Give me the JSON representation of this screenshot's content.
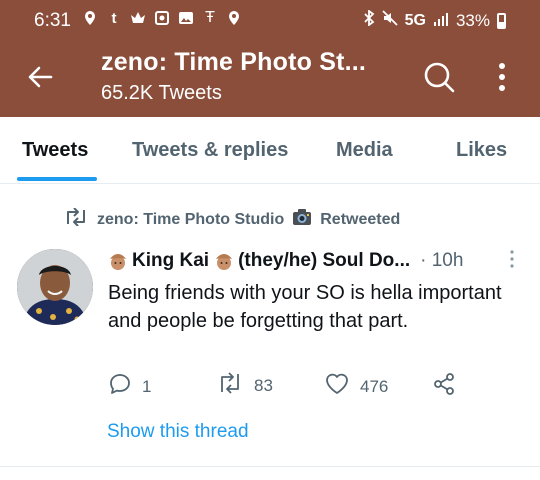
{
  "status_bar": {
    "time": "6:31",
    "left_icons": [
      "location-pin-icon",
      "tmobile-t-icon",
      "crown-icon",
      "app-square-icon",
      "gallery-icon",
      "tmobile-icon",
      "location-pin-icon"
    ],
    "network": "5G",
    "battery": "33%"
  },
  "header": {
    "title": "zeno: Time Photo St...",
    "subtitle": "65.2K Tweets",
    "background_color": "#8b4e3b"
  },
  "tabs": [
    {
      "label": "Tweets",
      "active": true
    },
    {
      "label": "Tweets & replies",
      "active": false
    },
    {
      "label": "Media",
      "active": false
    },
    {
      "label": "Likes",
      "active": false
    }
  ],
  "tweet": {
    "retweeted_by": "zeno: Time Photo Studio",
    "retweeted_suffix": "Retweeted",
    "author_name": "King Kai",
    "author_name_rest": "(they/he) Soul Do...",
    "time": "· 10h",
    "text": "Being friends with your SO is hella important and people be forgetting that part.",
    "replies": "1",
    "retweets": "83",
    "likes": "476",
    "show_thread": "Show this thread"
  },
  "colors": {
    "accent": "#1d9bf0",
    "muted_text": "#536471"
  }
}
